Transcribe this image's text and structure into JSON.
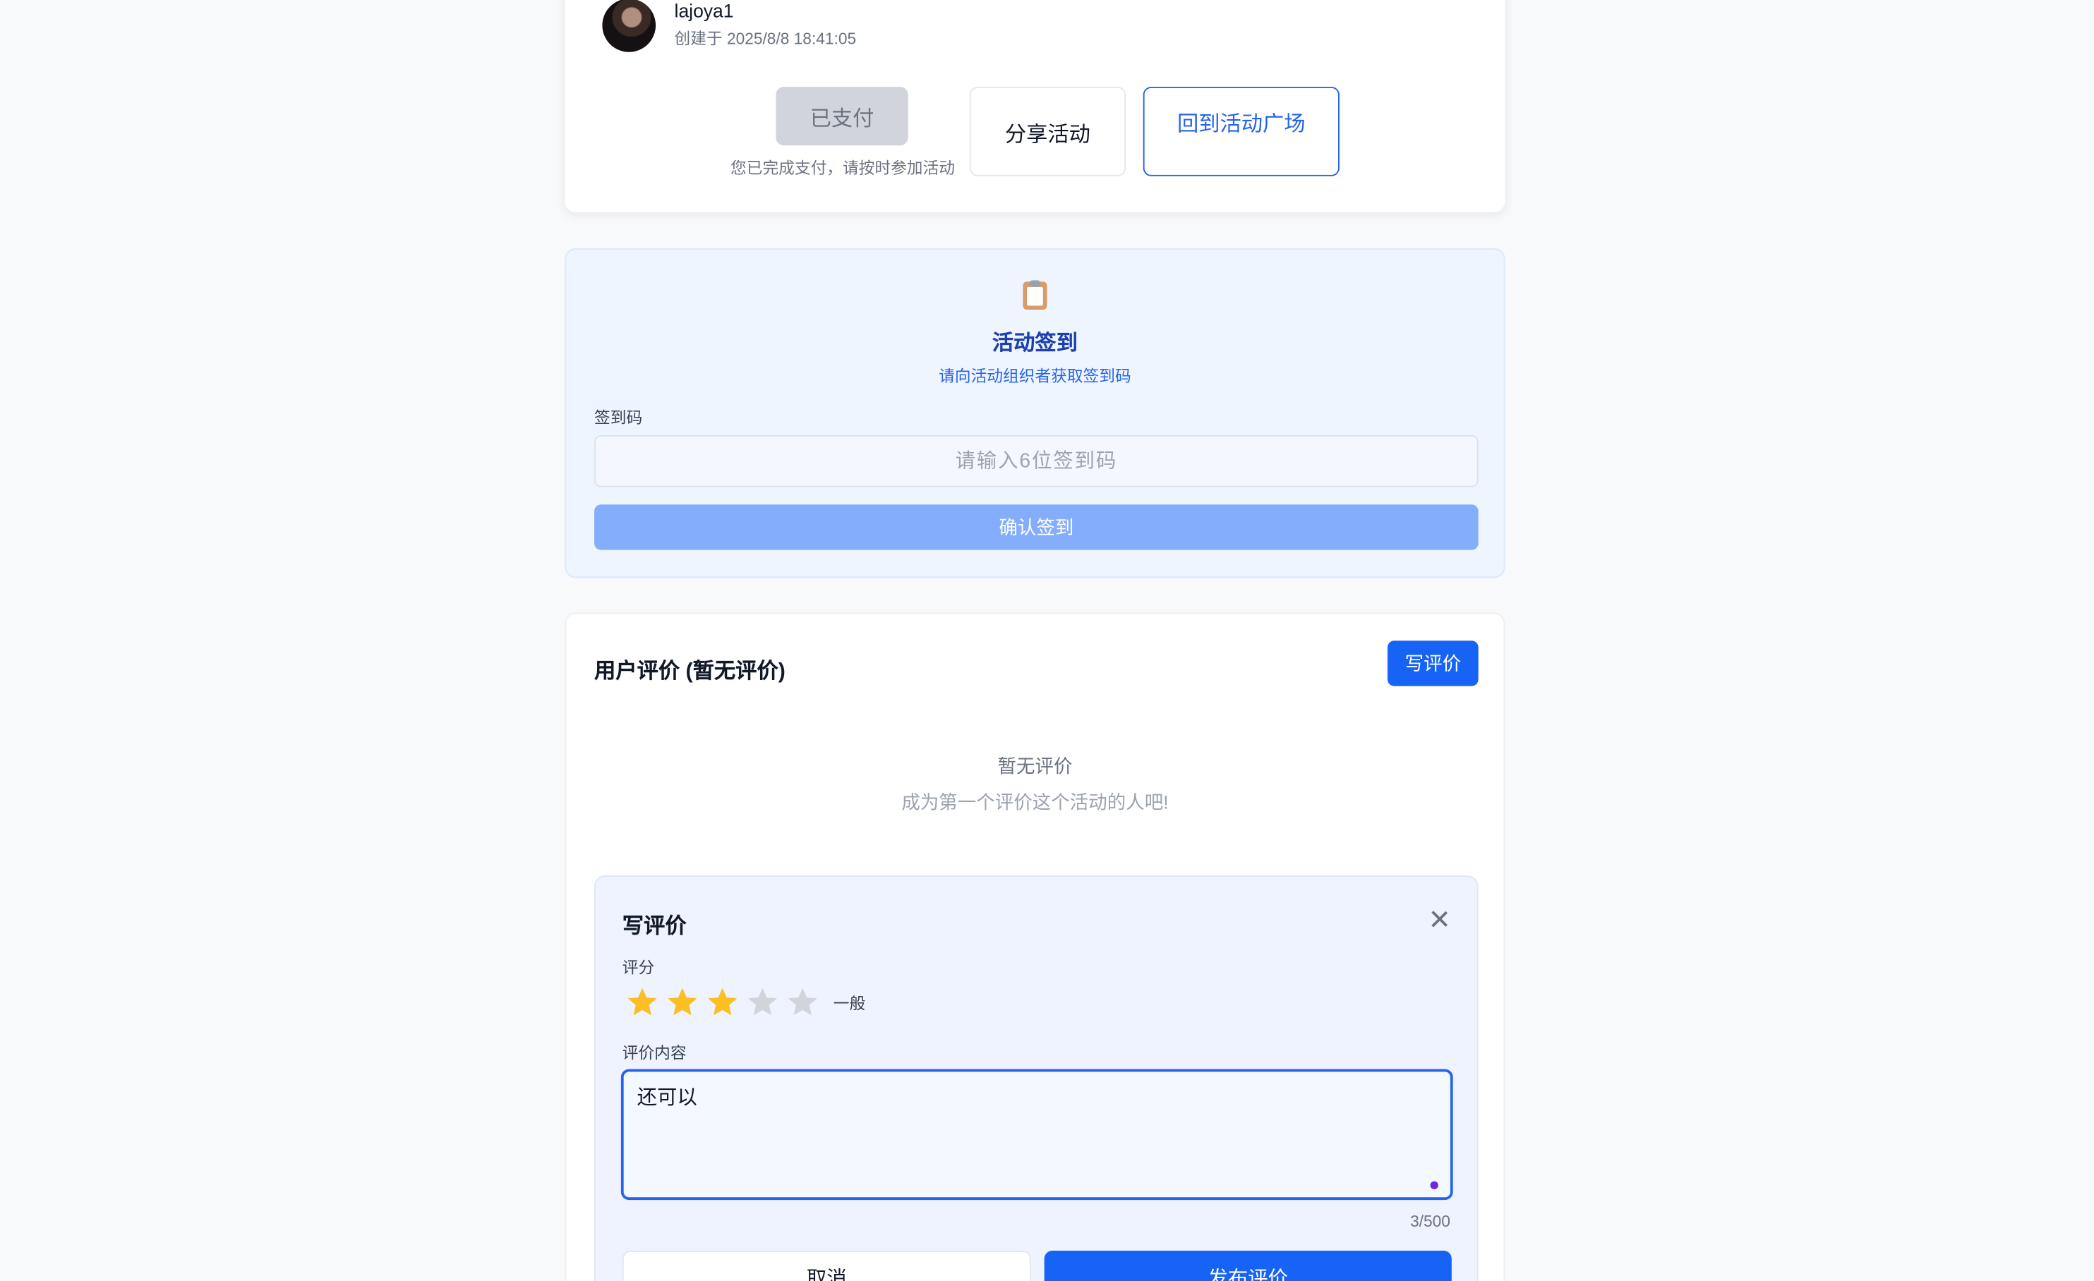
{
  "organizer": {
    "username": "lajoya1",
    "created": "创建于 2025/8/8 18:41:05"
  },
  "actions": {
    "paid_label": "已支付",
    "paid_note": "您已完成支付，请按时参加活动",
    "share_label": "分享活动",
    "back_label": "回到活动广场"
  },
  "checkin": {
    "icon": "clipboard-icon",
    "title": "活动签到",
    "subtitle": "请向活动组织者获取签到码",
    "code_label": "签到码",
    "code_placeholder": "请输入6位签到码",
    "code_value": "",
    "confirm_label": "确认签到"
  },
  "reviews": {
    "title": "用户评价 (暂无评价)",
    "write_label": "写评价",
    "empty_title": "暂无评价",
    "empty_sub": "成为第一个评价这个活动的人吧!"
  },
  "review_form": {
    "title": "写评价",
    "rating_label": "评分",
    "rating_value": 3,
    "rating_max": 5,
    "rating_text": "一般",
    "content_label": "评价内容",
    "content_value": "还可以",
    "counter": "3/500",
    "cancel_label": "取消",
    "publish_label": "发布评价"
  },
  "colors": {
    "primary": "#1663f5",
    "star_filled": "#fbbf24",
    "star_empty": "#d1d5db"
  }
}
